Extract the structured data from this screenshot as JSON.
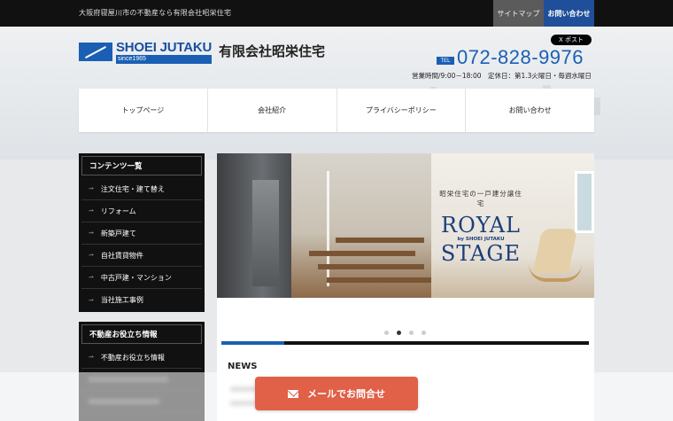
{
  "topbar": {
    "tagline": "大阪府寝屋川市の不動産なら有限会社昭栄住宅",
    "sitemap": "サイトマップ",
    "contact": "お問い合わせ"
  },
  "header": {
    "logo_name": "SHOEI JUTAKU",
    "logo_since": "since1965",
    "company_name": "有限会社昭栄住宅",
    "x_post": "X ポスト",
    "tel_badge": "TEL",
    "tel_number": "072-828-9976",
    "hours": "営業時間/9:00－18:00　定休日：第1.3火曜日・毎週水曜日"
  },
  "nav": [
    {
      "label": "トップページ"
    },
    {
      "label": "会社紹介"
    },
    {
      "label": "プライバシーポリシー"
    },
    {
      "label": "お問い合わせ"
    }
  ],
  "sidebar": {
    "contents_title": "コンテンツ一覧",
    "contents": [
      {
        "label": "注文住宅・建て替え"
      },
      {
        "label": "リフォーム"
      },
      {
        "label": "新築戸建て"
      },
      {
        "label": "自社賃貸物件"
      },
      {
        "label": "中古戸建・マンション"
      },
      {
        "label": "当社施工事例"
      }
    ],
    "info_title": "不動産お役立ち情報",
    "info": [
      {
        "label": "不動産お役立ち情報"
      }
    ]
  },
  "slider": {
    "sub": "昭栄住宅の一戸建分譲住宅",
    "line1": "ROYAL",
    "by": "by SHOEI JUTAKU",
    "line2": "STAGE",
    "active_slide": 2,
    "slide_count": 4,
    "progress": 0.17
  },
  "news": {
    "title": "NEWS"
  },
  "mail_button": {
    "label": "メールでお問合せ",
    "color": "#e06048"
  },
  "colors": {
    "brand": "#1a5fb4",
    "dark": "#111111"
  }
}
